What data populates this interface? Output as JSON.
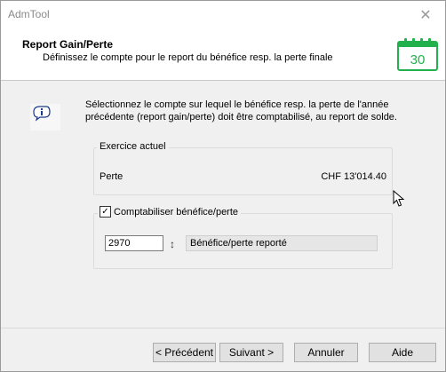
{
  "window": {
    "title": "AdmTool",
    "close_glyph": "✕"
  },
  "header": {
    "title": "Report Gain/Perte",
    "subtitle": "Définissez le compte pour le report du bénéfice resp. la perte finale",
    "calendar_day": "30",
    "calendar_icon": "calendar-icon",
    "accent_color": "#22b14c"
  },
  "info": {
    "icon": "info-balloon-icon",
    "text_line1": "Sélectionnez le compte sur lequel le bénéfice resp. la perte de l'année",
    "text_line2": "précédente (report gain/perte) doit être comptabilisé, au report de solde."
  },
  "exercice": {
    "legend": "Exercice actuel",
    "label": "Perte",
    "value": "CHF 13'014.40"
  },
  "comptabiliser": {
    "checkbox_label": "Comptabiliser bénéfice/perte",
    "checked": true,
    "check_glyph": "✓",
    "account_value": "2970",
    "spin_glyph": "↕",
    "description": "Bénéfice/perte reporté"
  },
  "buttons": {
    "prev": "< Précédent",
    "next": "Suivant >",
    "cancel": "Annuler",
    "help": "Aide"
  }
}
